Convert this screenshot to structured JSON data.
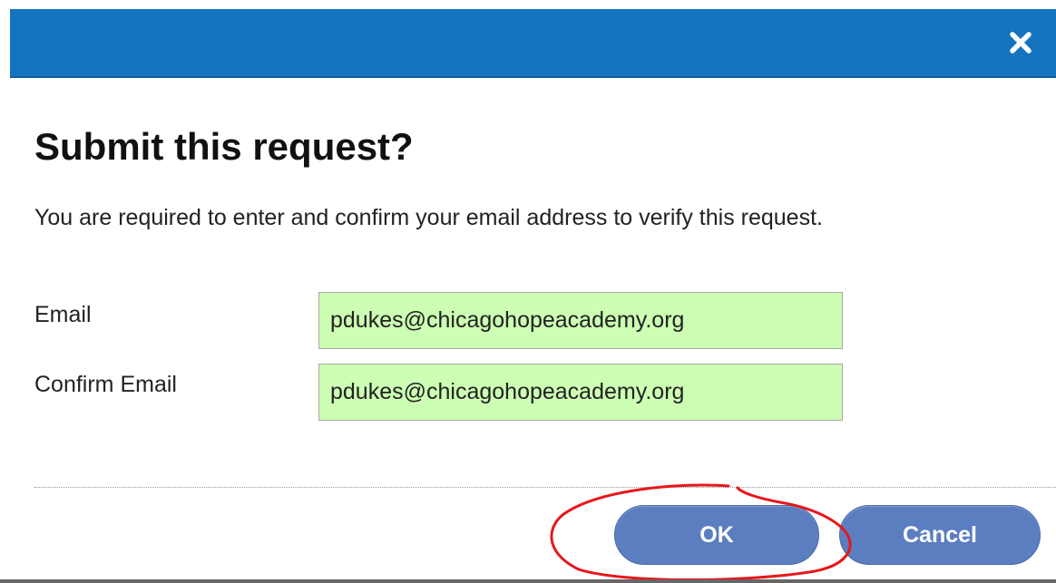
{
  "dialog": {
    "close_icon": "close-icon",
    "title": "Submit this request?",
    "message": "You are required to enter and confirm your email address to verify this request."
  },
  "form": {
    "email_label": "Email",
    "email_value": "pdukes@chicagohopeacademy.org",
    "confirm_label": "Confirm Email",
    "confirm_value": "pdukes@chicagohopeacademy.org"
  },
  "buttons": {
    "ok_label": "OK",
    "cancel_label": "Cancel"
  },
  "colors": {
    "title_bar": "#1474bf",
    "input_background": "#ccffb3",
    "button": "#5b7ec1",
    "annotation": "#e8161a"
  }
}
